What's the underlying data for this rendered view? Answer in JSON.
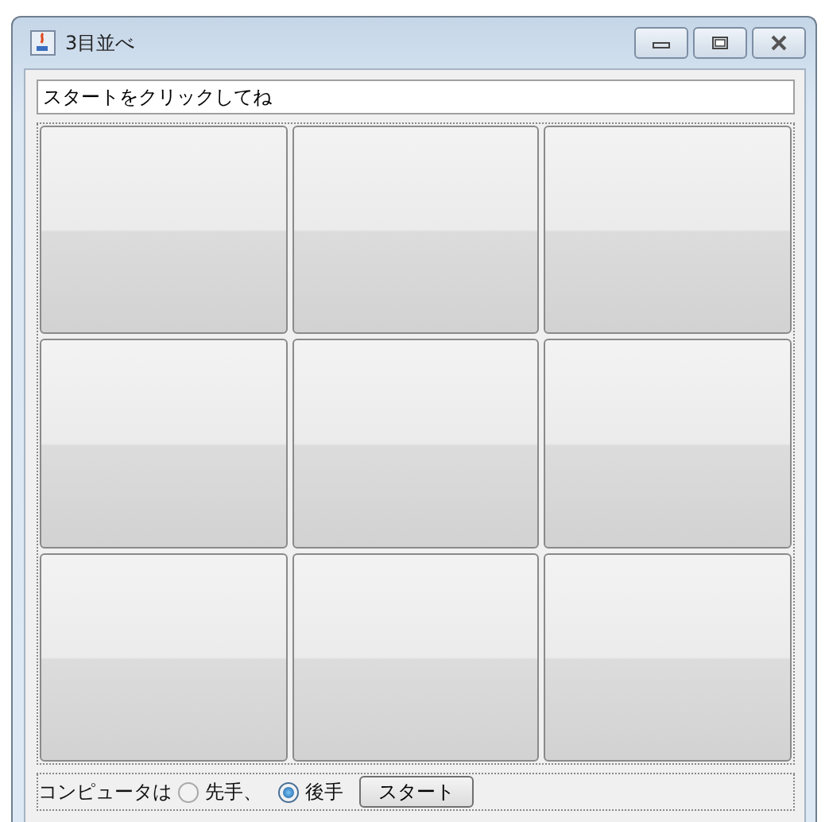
{
  "window": {
    "title": "3目並べ"
  },
  "message": "スタートをクリックしてね",
  "board": {
    "cells": [
      {
        "kind": "button"
      },
      {
        "kind": "button"
      },
      {
        "kind": "button"
      },
      {
        "kind": "button"
      },
      {
        "kind": "button"
      },
      {
        "kind": "button"
      },
      {
        "kind": "button"
      },
      {
        "kind": "button"
      },
      {
        "kind": "button"
      }
    ]
  },
  "controls": {
    "label": "コンピュータは",
    "options": [
      {
        "label": "先手、",
        "selected": false
      },
      {
        "label": "後手",
        "selected": true
      }
    ],
    "button": "スタート"
  }
}
